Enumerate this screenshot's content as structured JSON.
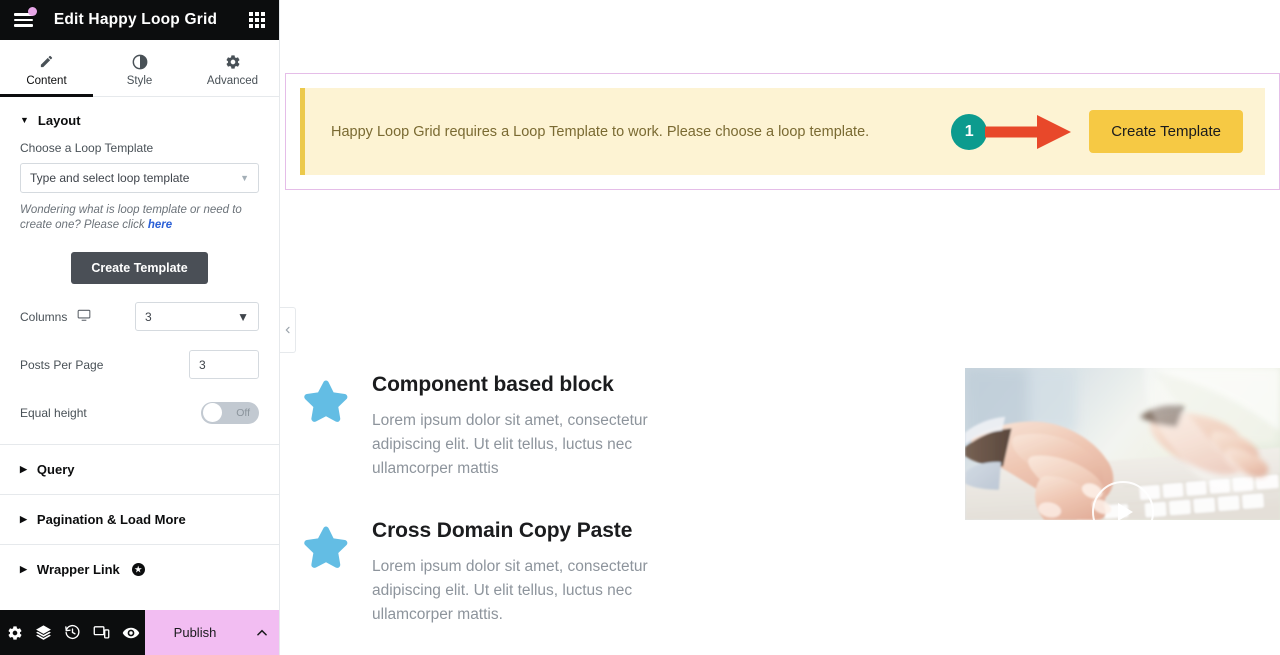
{
  "panel": {
    "header": {
      "menu_icon": "hamburger-menu-icon",
      "title": "Edit Happy Loop Grid",
      "widgets_icon": "widgets-grid-icon"
    },
    "tabs": [
      {
        "label": "Content",
        "icon": "pencil-icon",
        "active": true
      },
      {
        "label": "Style",
        "icon": "contrast-circle-icon",
        "active": false
      },
      {
        "label": "Advanced",
        "icon": "gear-icon",
        "active": false
      }
    ],
    "layout_section": {
      "title": "Layout",
      "choose_template_label": "Choose a Loop Template",
      "template_select_value": "Type and select loop template",
      "hint_text": "Wondering what is loop template or need to create one? Please click ",
      "hint_link": "here",
      "create_template_button": "Create Template",
      "columns_label": "Columns",
      "columns_device_icon": "desktop-icon",
      "columns_value": "3",
      "posts_per_page_label": "Posts Per Page",
      "posts_per_page_value": "3",
      "equal_height_label": "Equal height",
      "equal_height_state": "Off"
    },
    "accordions": [
      {
        "label": "Query",
        "pro": false
      },
      {
        "label": "Pagination & Load More",
        "pro": false
      },
      {
        "label": "Wrapper Link",
        "pro": true
      }
    ],
    "footer": {
      "icons": [
        "settings-gear-icon",
        "navigator-layers-icon",
        "history-clock-icon",
        "responsive-device-icon",
        "preview-eye-icon"
      ],
      "publish_label": "Publish",
      "publish_arrow_icon": "chevron-up-icon"
    },
    "collapse_handle_icon": "chevron-left-icon"
  },
  "canvas": {
    "notice": {
      "message": "Happy Loop Grid requires a Loop Template to work. Please choose a loop template.",
      "accent_color": "#ecc94b",
      "background_color": "#fdf3d3"
    },
    "annotation": {
      "step_number": "1",
      "badge_color": "#0c9b8e",
      "arrow_color": "#e8482a",
      "arrow_icon": "right-arrow-icon"
    },
    "create_template_button": {
      "label": "Create Template",
      "color": "#f6c944"
    },
    "selection_border_color": "#e5bde8",
    "features": [
      {
        "icon": "star-icon",
        "icon_color": "#63bde4",
        "title": "Component based block",
        "text": "Lorem ipsum dolor sit amet, consectetur adipiscing elit. Ut elit tellus, luctus nec ullamcorper mattis"
      },
      {
        "icon": "star-icon",
        "icon_color": "#63bde4",
        "title": "Cross Domain Copy Paste",
        "text": "Lorem ipsum dolor sit amet, consectetur adipiscing elit. Ut elit tellus, luctus nec ullamcorper mattis."
      }
    ],
    "media": {
      "alt": "hands typing on a white keyboard",
      "play_icon": "play-button-icon"
    }
  }
}
